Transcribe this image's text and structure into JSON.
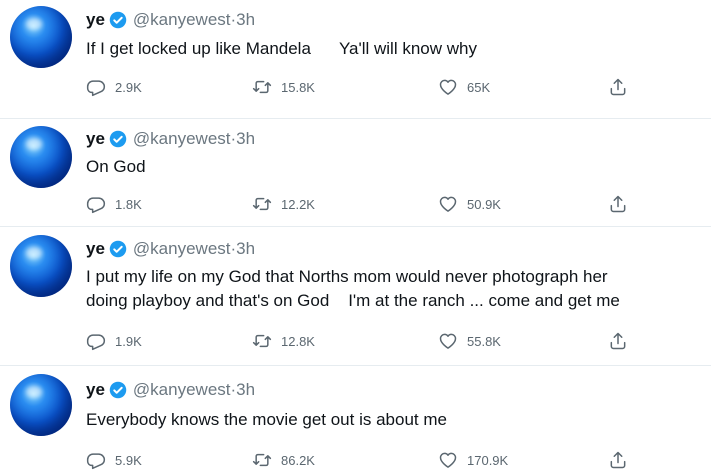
{
  "tweets": [
    {
      "name": "ye",
      "handle": "@kanyewest",
      "separator": "·",
      "time": "3h",
      "text": "If I get locked up like Mandela      Ya'll will know why",
      "replies": "2.9K",
      "retweets": "15.8K",
      "likes": "65K"
    },
    {
      "name": "ye",
      "handle": "@kanyewest",
      "separator": "·",
      "time": "3h",
      "text": "On God",
      "replies": "1.8K",
      "retweets": "12.2K",
      "likes": "50.9K"
    },
    {
      "name": "ye",
      "handle": "@kanyewest",
      "separator": "·",
      "time": "3h",
      "text": "I put my life on my God that Norths mom would never photograph her\ndoing playboy and that's on God    I'm at the ranch ... come and get me",
      "replies": "1.9K",
      "retweets": "12.8K",
      "likes": "55.8K"
    },
    {
      "name": "ye",
      "handle": "@kanyewest",
      "separator": "·",
      "time": "3h",
      "text": "Everybody knows the movie get out is about me",
      "replies": "5.9K",
      "retweets": "86.2K",
      "likes": "170.9K"
    }
  ],
  "icons": {
    "verified": "verified-badge-icon",
    "reply": "reply-icon",
    "retweet": "retweet-icon",
    "like": "heart-icon",
    "share": "share-icon"
  },
  "colors": {
    "verified": "#1d9bf0",
    "secondary_text": "#5b6770",
    "divider": "#e6ecf0"
  }
}
